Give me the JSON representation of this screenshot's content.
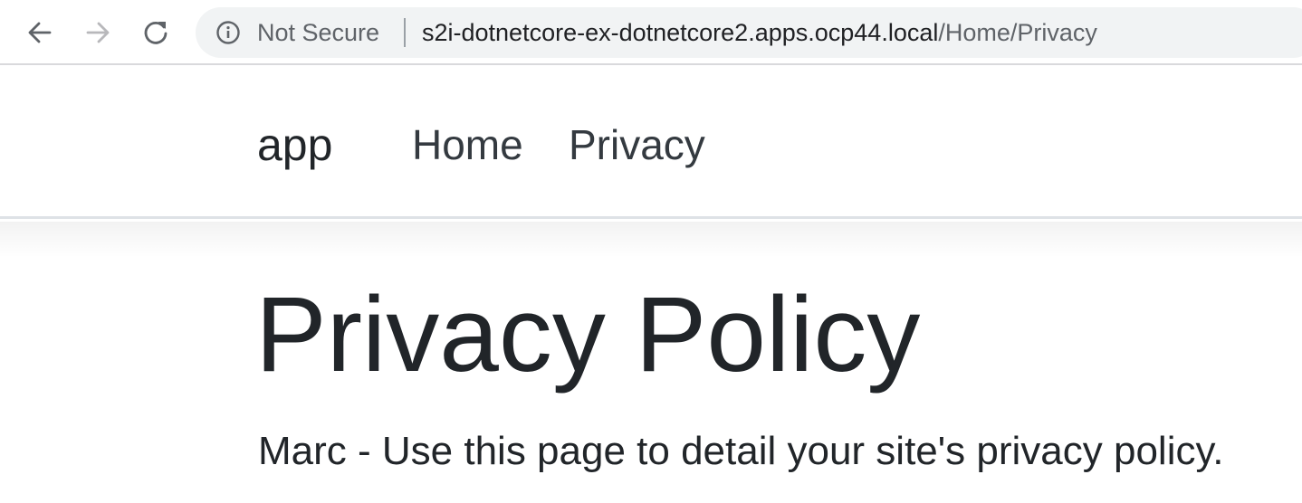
{
  "browser": {
    "security_label": "Not Secure",
    "url_host": "s2i-dotnetcore-ex-dotnetcore2.apps.ocp44.local",
    "url_path": "/Home/Privacy",
    "icons": {
      "back": "arrow-left-icon",
      "forward": "arrow-right-icon",
      "reload": "reload-icon",
      "info": "info-circle-icon"
    }
  },
  "navbar": {
    "brand": "app",
    "links": [
      {
        "label": "Home"
      },
      {
        "label": "Privacy"
      }
    ]
  },
  "main": {
    "title": "Privacy Policy",
    "body": "Marc - Use this page to detail your site's privacy policy."
  },
  "colors": {
    "text_primary": "#212529",
    "nav_link": "#343a40",
    "omnibox_bg": "#f1f3f4",
    "muted": "#5f6368",
    "forward_disabled": "#b8b8bb"
  }
}
